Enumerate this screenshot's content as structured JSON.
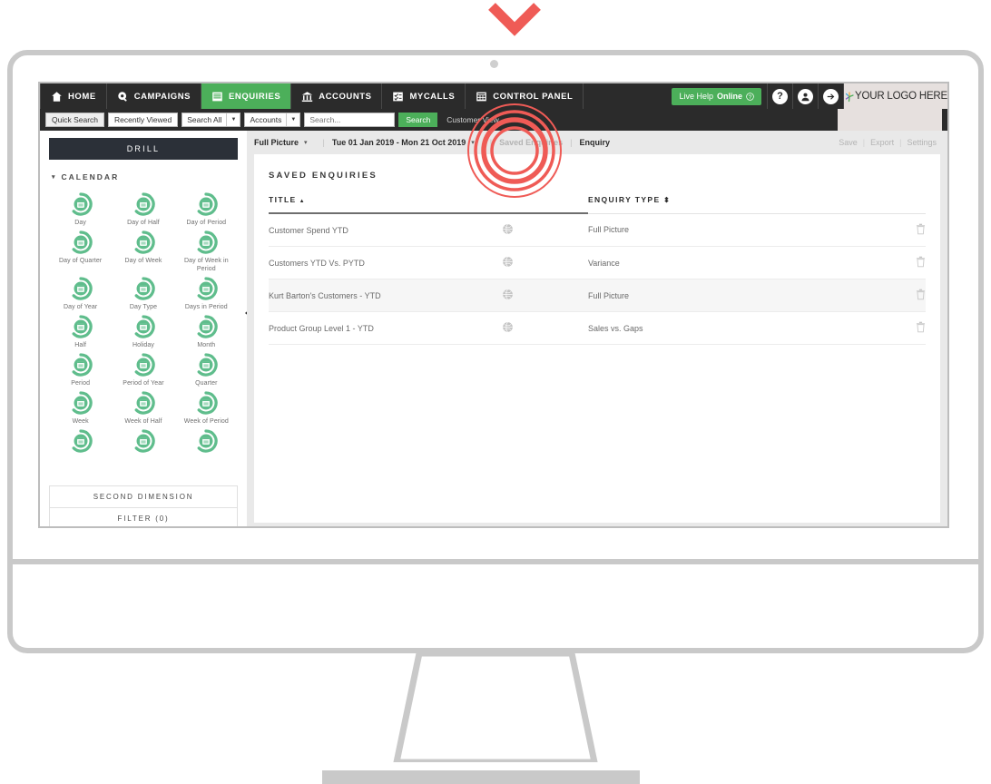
{
  "annotations": {
    "chevron_icon": "chevron-down-icon",
    "click_indicator": "click-target-rings",
    "accent_red": "#ef5b56"
  },
  "theme": {
    "nav_bg": "#2b2b2b",
    "accent_green": "#4caf5a",
    "icon_green": "#5fbd8c",
    "content_bg": "#e9e9e9",
    "drill_bg": "#2b3038"
  },
  "topnav": {
    "items": [
      {
        "label": "HOME",
        "icon": "home-icon",
        "active": false
      },
      {
        "label": "CAMPAIGNS",
        "icon": "megaphone-icon",
        "active": false
      },
      {
        "label": "ENQUIRIES",
        "icon": "enquiries-icon",
        "active": true
      },
      {
        "label": "ACCOUNTS",
        "icon": "bank-icon",
        "active": false
      },
      {
        "label": "MYCALLS",
        "icon": "checklist-icon",
        "active": false
      },
      {
        "label": "CONTROL PANEL",
        "icon": "grid-panel-icon",
        "active": false
      }
    ],
    "live_help_prefix": "Live Help",
    "live_help_status": "Online",
    "help_icon": "question-mark-icon",
    "user_icon": "user-avatar-icon",
    "logout_icon": "arrow-right-icon",
    "logo_text": "YOUR LOGO HERE",
    "logo_icon": "brand-star-icon"
  },
  "searchbar": {
    "quick_search": "Quick Search",
    "recently_viewed": "Recently Viewed",
    "scope_select": "Search All",
    "entity_select": "Accounts",
    "search_placeholder": "Search...",
    "search_button": "Search",
    "customer_view": "Customer View"
  },
  "sidebar": {
    "drill_label": "DRILL",
    "calendar_label": "CALENDAR",
    "calendar_caret": "▾",
    "collapse_handle": "collapse-sidebar-handle",
    "items": [
      "Day",
      "Day of Half",
      "Day of Period",
      "Day of Quarter",
      "Day of Week",
      "Day of Week in Period",
      "Day of Year",
      "Day Type",
      "Days in Period",
      "Half",
      "Holiday",
      "Month",
      "Period",
      "Period of Year",
      "Quarter",
      "Week",
      "Week of Half",
      "Week of Period",
      "",
      "",
      ""
    ],
    "second_dimension": "SECOND DIMENSION",
    "filter": "FILTER (0)"
  },
  "breadcrumb": {
    "view": "Full Picture",
    "caret": "▾",
    "date_range": "Tue 01 Jan 2019 - Mon 21 Oct 2019",
    "date_caret": "▾",
    "saved_enquiries": "Saved Enquiries",
    "enquiry": "Enquiry",
    "actions": {
      "save": "Save",
      "export": "Export",
      "settings": "Settings"
    }
  },
  "panel": {
    "title": "SAVED ENQUIRIES",
    "columns": {
      "title": "TITLE",
      "title_sort": "asc",
      "enquiry_type": "ENQUIRY TYPE",
      "enquiry_type_sort": "both"
    },
    "rows": [
      {
        "title": "Customer Spend YTD",
        "globe": "globe-icon",
        "type": "Full Picture",
        "bin": "trash-icon"
      },
      {
        "title": "Customers YTD Vs. PYTD",
        "globe": "globe-icon",
        "type": "Variance",
        "bin": "trash-icon"
      },
      {
        "title": "Kurt Barton's Customers - YTD",
        "globe": "globe-icon",
        "type": "Full Picture",
        "bin": "trash-icon"
      },
      {
        "title": "Product Group Level 1 - YTD",
        "globe": "globe-icon",
        "type": "Sales vs. Gaps",
        "bin": "trash-icon"
      }
    ]
  }
}
